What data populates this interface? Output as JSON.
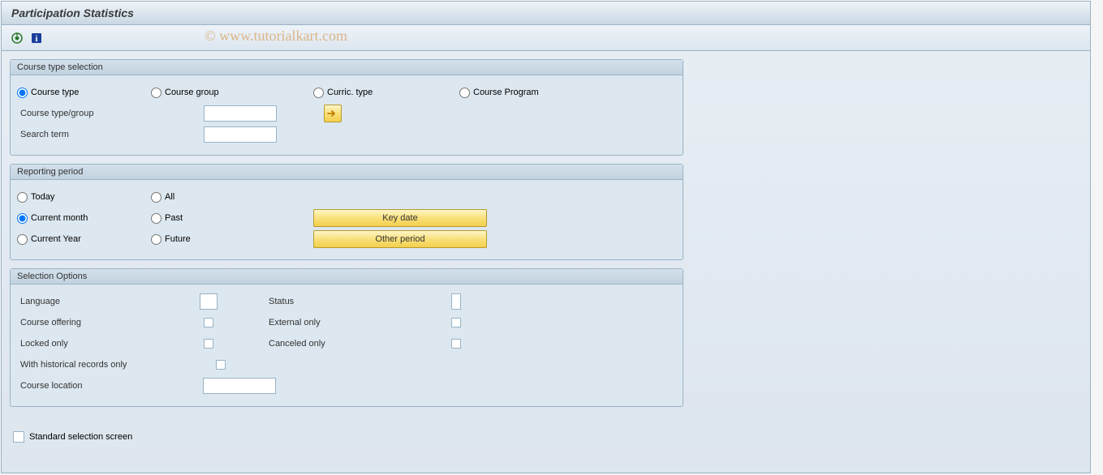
{
  "header": {
    "title": "Participation Statistics"
  },
  "watermark": "© www.tutorialkart.com",
  "toolbar": {
    "execute_icon": "execute-icon",
    "info_icon": "info-icon"
  },
  "groups": {
    "course_type": {
      "title": "Course type selection",
      "radios": {
        "course_type": "Course type",
        "course_group": "Course group",
        "curric_type": "Curric. type",
        "course_program": "Course Program"
      },
      "fields": {
        "course_type_group_label": "Course type/group",
        "course_type_group_value": "",
        "search_term_label": "Search term",
        "search_term_value": ""
      }
    },
    "reporting": {
      "title": "Reporting period",
      "radios_left": {
        "today": "Today",
        "current_month": "Current month",
        "current_year": "Current Year"
      },
      "radios_mid": {
        "all": "All",
        "past": "Past",
        "future": "Future"
      },
      "buttons": {
        "key_date": "Key date",
        "other_period": "Other period"
      }
    },
    "selection": {
      "title": "Selection Options",
      "left": {
        "language": "Language",
        "course_offering": "Course offering",
        "locked_only": "Locked only",
        "with_historical": "With historical records only",
        "course_location": "Course location",
        "course_location_value": ""
      },
      "right": {
        "status": "Status",
        "external_only": "External only",
        "canceled_only": "Canceled only"
      }
    }
  },
  "footer": {
    "standard_label": "Standard selection screen"
  }
}
